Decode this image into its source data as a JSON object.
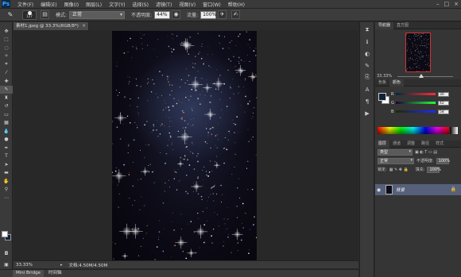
{
  "app": {
    "logo": "Ps"
  },
  "menu": [
    "文件(F)",
    "编辑(E)",
    "图像(I)",
    "图层(L)",
    "文字(Y)",
    "选择(S)",
    "滤镜(T)",
    "视图(V)",
    "窗口(W)",
    "帮助(H)"
  ],
  "options": {
    "brush_size": "127",
    "mode_label": "模式:",
    "mode_value": "正常",
    "opacity_label": "不透明度:",
    "opacity_value": "44%",
    "flow_label": "流量:",
    "flow_value": "100%"
  },
  "document": {
    "tab_title": "素材1.jpeg @ 33.3%(RGB/8*)",
    "close": "×"
  },
  "status": {
    "zoom": "33.33%",
    "doc_info": "文档:4.50M/4.50M"
  },
  "bottom_tabs": [
    "Mini Bridge",
    "时间轴"
  ],
  "navigator": {
    "tabs": [
      "导航器",
      "直方图"
    ],
    "zoom": "33.33%"
  },
  "color_panel": {
    "tabs": [
      "色板",
      "颜色"
    ],
    "fg_color": "#10213a",
    "channels": [
      {
        "label": "R",
        "value": "30"
      },
      {
        "label": "G",
        "value": "42"
      },
      {
        "label": "B",
        "value": "58"
      }
    ]
  },
  "layers": {
    "tabs": [
      "图层",
      "通道",
      "调整",
      "路径",
      "样式"
    ],
    "filter_label": "类型",
    "blend_mode": "正常",
    "opacity_label": "不透明度:",
    "opacity_value": "100%",
    "lock_label": "锁定:",
    "fill_label": "填充:",
    "fill_value": "100%",
    "items": [
      {
        "name": "背景",
        "visible": true,
        "locked": true
      }
    ]
  },
  "colors": {
    "selection": "#56607a",
    "nav_border": "#d23232"
  }
}
